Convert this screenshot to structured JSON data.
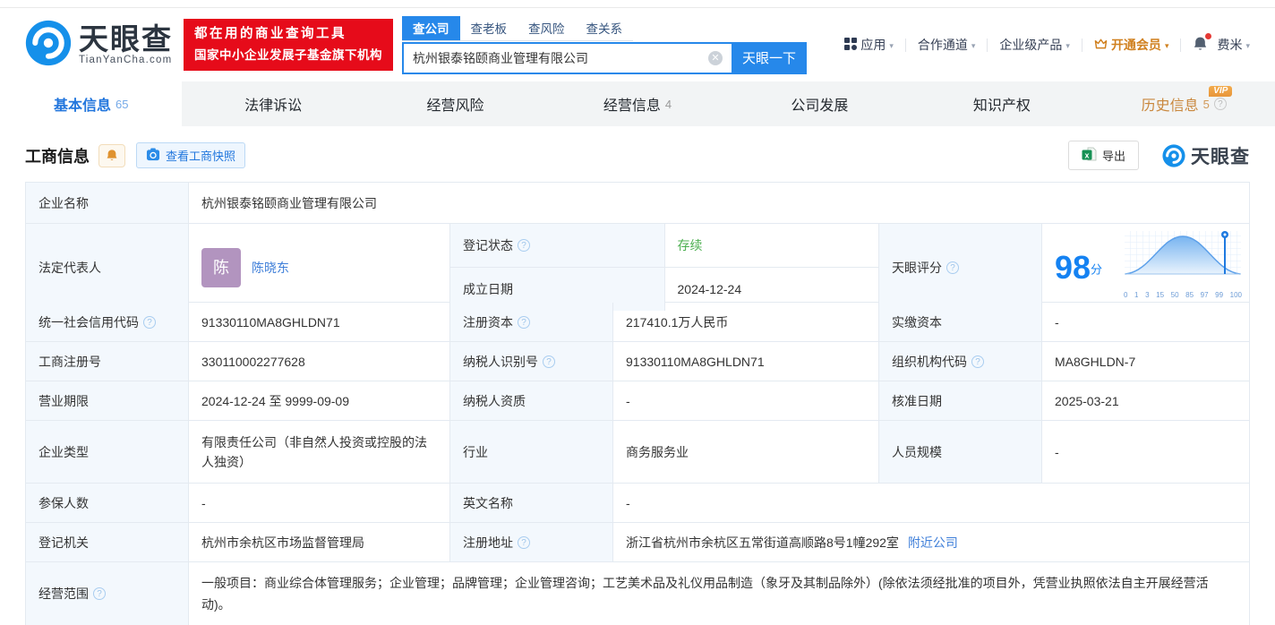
{
  "colors": {
    "accent": "#2688ea",
    "link": "#3f7fd9",
    "status_green": "#4caf50",
    "vip_orange": "#d0801f",
    "banner_red": "#e60b1a",
    "score_blue": "#1582f2"
  },
  "header": {
    "logo_title": "天眼查",
    "logo_subtitle": "TianYanCha.com",
    "banner_line1": "都在用的商业查询工具",
    "banner_line2": "国家中小企业发展子基金旗下机构",
    "search_tabs": [
      {
        "label": "查公司"
      },
      {
        "label": "查老板"
      },
      {
        "label": "查风险"
      },
      {
        "label": "查关系"
      }
    ],
    "search_value": "杭州银泰铭颐商业管理有限公司",
    "search_button": "天眼一下",
    "nav_apps": "应用",
    "nav_partner": "合作通道",
    "nav_enterprise": "企业级产品",
    "nav_vip": "开通会员",
    "nav_user": "费米"
  },
  "page_tabs": [
    {
      "label": "基本信息",
      "count": "65"
    },
    {
      "label": "法律诉讼",
      "count": ""
    },
    {
      "label": "经营风险",
      "count": ""
    },
    {
      "label": "经营信息",
      "count": "4"
    },
    {
      "label": "公司发展",
      "count": ""
    },
    {
      "label": "知识产权",
      "count": ""
    },
    {
      "label": "历史信息",
      "count": "5",
      "badge": "VIP"
    }
  ],
  "section": {
    "title": "工商信息",
    "snapshot_button": "查看工商快照",
    "export_button": "导出",
    "watermark": "天眼查"
  },
  "score": {
    "label": "天眼评分",
    "value": "98",
    "unit": "分",
    "axis_labels": [
      "0",
      "1",
      "3",
      "15",
      "50",
      "85",
      "97",
      "99",
      "100"
    ]
  },
  "fields": {
    "company_name": {
      "label": "企业名称",
      "value": "杭州银泰铭颐商业管理有限公司"
    },
    "legal_rep": {
      "label": "法定代表人",
      "avatar": "陈",
      "value": "陈晓东"
    },
    "reg_status": {
      "label": "登记状态",
      "value": "存续"
    },
    "establish_date": {
      "label": "成立日期",
      "value": "2024-12-24"
    },
    "credit_code": {
      "label": "统一社会信用代码",
      "value": "91330110MA8GHLDN71"
    },
    "reg_capital": {
      "label": "注册资本",
      "value": "217410.1万人民币"
    },
    "paid_capital": {
      "label": "实缴资本",
      "value": "-"
    },
    "reg_number": {
      "label": "工商注册号",
      "value": "330110002277628"
    },
    "taxpayer_id": {
      "label": "纳税人识别号",
      "value": "91330110MA8GHLDN71"
    },
    "org_code": {
      "label": "组织机构代码",
      "value": "MA8GHLDN-7"
    },
    "business_term": {
      "label": "营业期限",
      "value": "2024-12-24 至 9999-09-09"
    },
    "taxpayer_quality": {
      "label": "纳税人资质",
      "value": "-"
    },
    "approval_date": {
      "label": "核准日期",
      "value": "2025-03-21"
    },
    "company_type": {
      "label": "企业类型",
      "value": "有限责任公司（非自然人投资或控股的法人独资）"
    },
    "industry": {
      "label": "行业",
      "value": "商务服务业"
    },
    "staff_size": {
      "label": "人员规模",
      "value": "-"
    },
    "insured_count": {
      "label": "参保人数",
      "value": "-"
    },
    "english_name": {
      "label": "英文名称",
      "value": "-"
    },
    "reg_authority": {
      "label": "登记机关",
      "value": "杭州市余杭区市场监督管理局"
    },
    "reg_address": {
      "label": "注册地址",
      "value": "浙江省杭州市余杭区五常街道高顺路8号1幢292室",
      "link": "附近公司"
    },
    "business_scope": {
      "label": "经营范围",
      "value": "一般项目：商业综合体管理服务；企业管理；品牌管理；企业管理咨询；工艺美术品及礼仪用品制造（象牙及其制品除外）(除依法须经批准的项目外，凭营业执照依法自主开展经营活动)。"
    }
  }
}
